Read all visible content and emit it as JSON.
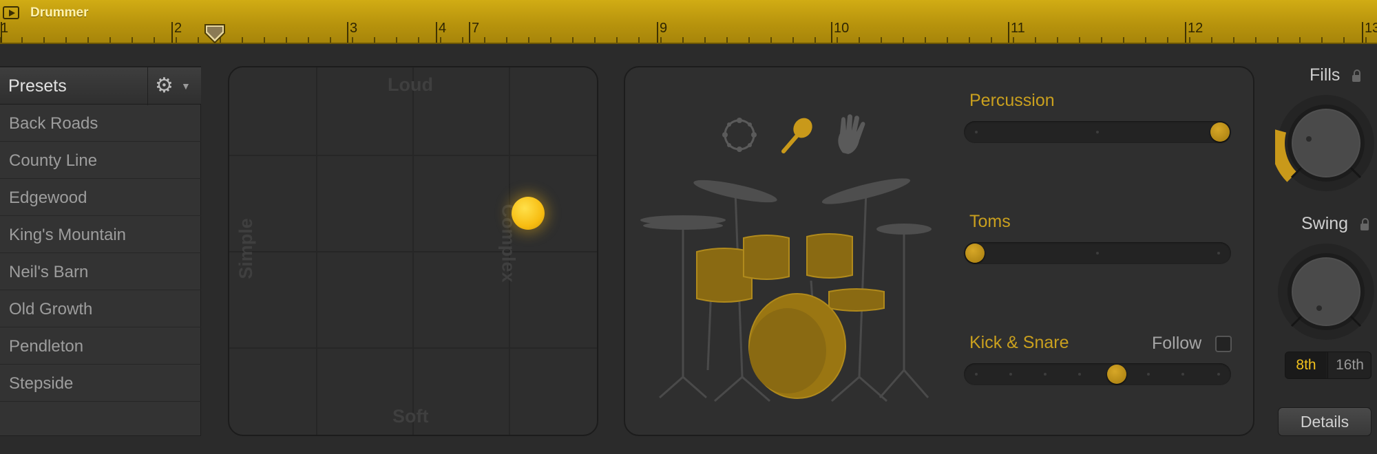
{
  "region": {
    "title": "Drummer",
    "icon": "play-region-icon",
    "ruler_numbers": [
      "1",
      "2",
      "3",
      "4",
      "7",
      "9",
      "10",
      "11",
      "12",
      "13"
    ]
  },
  "presets": {
    "title": "Presets",
    "gear_icon": "gear-icon",
    "items": [
      "Back Roads",
      "County Line",
      "Edgewood",
      "King's Mountain",
      "Neil's Barn",
      "Old Growth",
      "Pendleton",
      "Stepside"
    ]
  },
  "xy_pad": {
    "top_label": "Loud",
    "bottom_label": "Soft",
    "left_label": "Simple",
    "right_label": "Complex"
  },
  "kit": {
    "icons": [
      "tambourine-icon",
      "shaker-icon",
      "hand-clap-icon"
    ],
    "percussion_label": "Percussion",
    "percussion_value": 1.0,
    "toms_label": "Toms",
    "toms_value": 0.0,
    "kick_snare_label": "Kick & Snare",
    "kick_snare_value": 0.58,
    "follow_label": "Follow",
    "follow_checked": false
  },
  "controls": {
    "fills_label": "Fills",
    "swing_label": "Swing",
    "note_8th": "8th",
    "note_16th": "16th",
    "details_label": "Details"
  },
  "colors": {
    "accent": "#c9991a",
    "ruler": "#b8940d",
    "ball": "#f7bd12"
  }
}
